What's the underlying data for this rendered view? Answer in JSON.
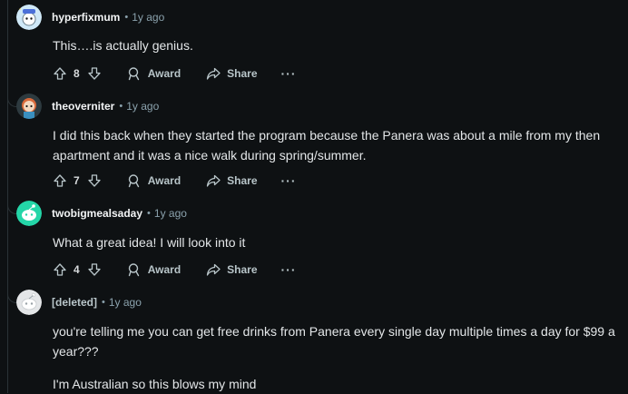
{
  "comments": [
    {
      "author": "hyperfixmum",
      "separator": "•",
      "time": "1y ago",
      "body": [
        "This….is actually genius."
      ],
      "votes": "8",
      "award_label": "Award",
      "share_label": "Share",
      "more_label": "···",
      "avatar_color": "#cfe8f7"
    },
    {
      "author": "theoverniter",
      "separator": "•",
      "time": "1y ago",
      "body": [
        "I did this back when they started the program because the Panera was about a mile from my then apartment and it was a nice walk during spring/summer."
      ],
      "votes": "7",
      "award_label": "Award",
      "share_label": "Share",
      "more_label": "···",
      "avatar_color": "#2d3a3f"
    },
    {
      "author": "twobigmealsaday",
      "separator": "•",
      "time": "1y ago",
      "body": [
        "What a great idea! I will look into it"
      ],
      "votes": "4",
      "award_label": "Award",
      "share_label": "Share",
      "more_label": "···",
      "avatar_color": "#24d6a8"
    },
    {
      "author": "[deleted]",
      "separator": "•",
      "time": "1y ago",
      "body": [
        "you're telling me you can get free drinks from Panera every single day multiple times a day for $99 a year???",
        "I'm Australian so this blows my mind"
      ],
      "avatar_color": "#e4e6e8"
    }
  ],
  "colors": {
    "background": "#0e1113",
    "meta": "#8ba2ad",
    "thread_line": "#2a3236"
  }
}
